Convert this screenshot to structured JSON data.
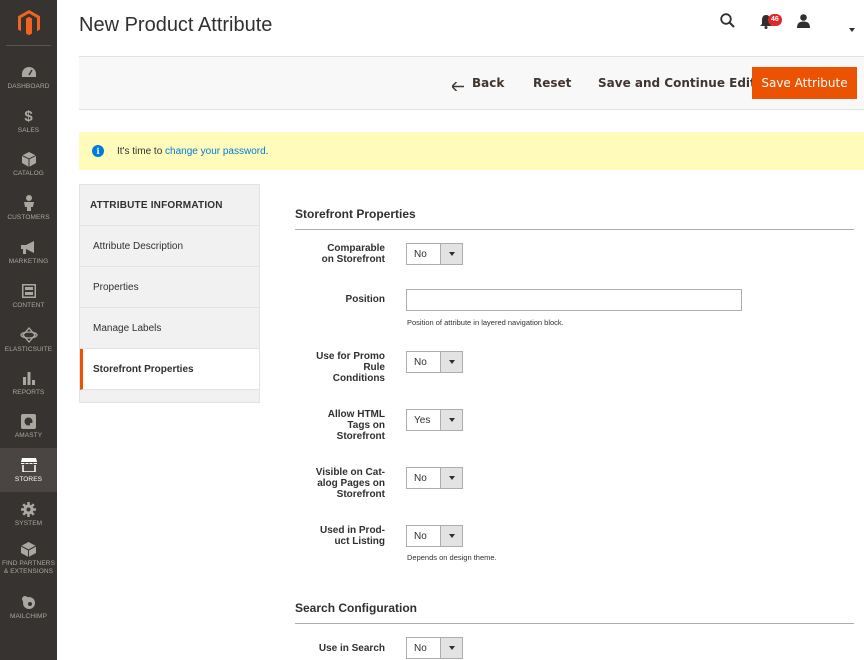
{
  "sidebar": {
    "items": [
      {
        "label": "DASHBOARD",
        "icon": "dashboard-icon"
      },
      {
        "label": "SALES",
        "icon": "dollar-icon"
      },
      {
        "label": "CATALOG",
        "icon": "cube-icon"
      },
      {
        "label": "CUSTOMERS",
        "icon": "person-icon"
      },
      {
        "label": "MARKETING",
        "icon": "megaphone-icon"
      },
      {
        "label": "CONTENT",
        "icon": "layout-icon"
      },
      {
        "label": "ELASTICSUITE",
        "icon": "elasticsuite-icon"
      },
      {
        "label": "REPORTS",
        "icon": "bar-chart-icon"
      },
      {
        "label": "AMASTY",
        "icon": "amasty-icon"
      },
      {
        "label": "STORES",
        "icon": "store-icon"
      },
      {
        "label": "SYSTEM",
        "icon": "gear-icon"
      },
      {
        "label": "FIND PARTNERS",
        "label2": "& EXTENSIONS",
        "icon": "partners-icon"
      },
      {
        "label": "MAILCHIMP",
        "icon": "mailchimp-icon"
      }
    ]
  },
  "header": {
    "title": "New Product Attribute",
    "notifications_count": "46"
  },
  "actions": {
    "back": "Back",
    "reset": "Reset",
    "save_continue": "Save and Continue Edit",
    "save": "Save Attribute"
  },
  "notice": {
    "prefix": "It's time to ",
    "link": "change your password",
    "suffix": "."
  },
  "tabs": {
    "heading": "ATTRIBUTE INFORMATION",
    "items": [
      "Attribute Description",
      "Properties",
      "Manage Labels",
      "Storefront Properties"
    ],
    "active_index": 3
  },
  "storefront": {
    "title": "Storefront Properties",
    "comparable": {
      "label1": "Comparable",
      "label2": "on Storefront",
      "value": "No"
    },
    "position": {
      "label": "Position",
      "value": "",
      "note": "Position of attribute in layered navigation block."
    },
    "promo": {
      "label1": "Use for Promo",
      "label2": "Rule",
      "label3": "Conditions",
      "value": "No"
    },
    "html_tags": {
      "label1": "Allow HTML",
      "label2": "Tags on",
      "label3": "Storefront",
      "value": "Yes"
    },
    "visible_catalog": {
      "label1": "Visible on Cat-",
      "label2": "alog Pages on",
      "label3": "Storefront",
      "value": "No"
    },
    "product_listing": {
      "label1": "Used in Prod-",
      "label2": "uct Listing",
      "value": "No",
      "note": "Depends on design theme."
    }
  },
  "search": {
    "title": "Search Configuration",
    "use_in_search": {
      "label": "Use in Search",
      "value": "No"
    }
  },
  "colors": {
    "accent": "#eb5202",
    "sidebar_bg": "#373330",
    "notice_bg": "#fffbbb",
    "link": "#007bdb"
  }
}
